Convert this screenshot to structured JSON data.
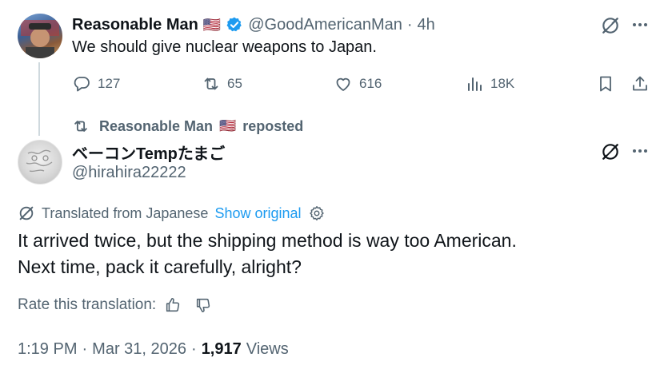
{
  "tweet": {
    "author_name": "Reasonable Man",
    "flag": "🇺🇸",
    "handle": "@GoodAmericanMan",
    "separator": "·",
    "time_ago": "4h",
    "text": "We should give nuclear weapons to Japan.",
    "metrics": {
      "replies": "127",
      "reposts": "65",
      "likes": "616",
      "views": "18K"
    }
  },
  "repost_banner": {
    "name": "Reasonable Man",
    "flag": "🇺🇸",
    "suffix": "reposted"
  },
  "quoted": {
    "author_name": "ベーコンTempたまご",
    "handle": "@hirahira22222",
    "translated_label": "Translated from Japanese",
    "show_original": "Show original",
    "text_line1": "It arrived twice, but the shipping method is way too American.",
    "text_line2": "Next time, pack it carefully, alright?",
    "rate_label": "Rate this translation:",
    "time": "1:19 PM",
    "dot": "·",
    "date": "Mar 31, 2026",
    "dot2": "·",
    "views_count": "1,917",
    "views_label": "Views"
  },
  "colors": {
    "text": "#0f1419",
    "muted": "#536471",
    "accent": "#1d9bf0",
    "verified": "#1d9bf0"
  },
  "icons": [
    "grok-icon",
    "more-icon",
    "reply-icon",
    "repost-icon",
    "like-icon",
    "views-icon",
    "bookmark-icon",
    "share-icon",
    "translate-icon",
    "settings-icon",
    "thumbs-up-icon",
    "thumbs-down-icon",
    "verified-badge-icon"
  ]
}
